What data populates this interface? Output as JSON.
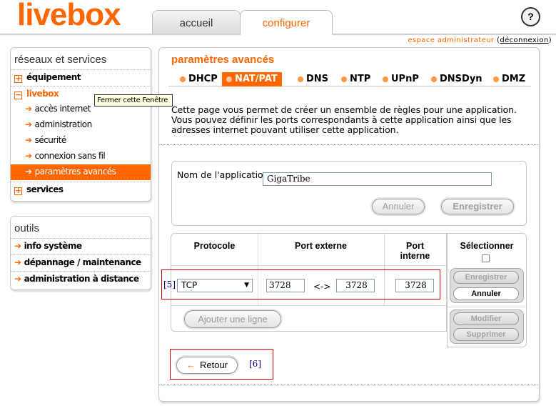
{
  "header": {
    "logo": "livebox",
    "tabs": [
      {
        "label": "accueil",
        "active": false
      },
      {
        "label": "configurer",
        "active": true
      }
    ],
    "help_label": "?",
    "admin_space": "espace administrateur",
    "open_paren": "(",
    "logout": "déconnexion",
    "close_paren": ")"
  },
  "sidebar": {
    "networks": {
      "title": "réseaux et services",
      "items": [
        {
          "label": "équipement",
          "icon": "plus"
        },
        {
          "label": "livebox",
          "icon": "minus"
        },
        {
          "label": "accès internet"
        },
        {
          "label": "administration"
        },
        {
          "label": "sécurité"
        },
        {
          "label": "connexion sans fil"
        },
        {
          "label": "paramètres avancés",
          "active": true
        },
        {
          "label": "services",
          "icon": "plus"
        }
      ]
    },
    "tools": {
      "title": "outils",
      "items": [
        {
          "label": "info système"
        },
        {
          "label": "dépannage / maintenance"
        },
        {
          "label": "administration à distance"
        }
      ]
    }
  },
  "tooltip": "Fermer cette Fenêtre",
  "main": {
    "title": "paramètres avancés",
    "subnav": [
      "DHCP",
      "NAT/PAT",
      "DNS",
      "NTP",
      "UPnP",
      "DNSDyn",
      "DMZ"
    ],
    "subnav_active": "NAT/PAT",
    "description": "Cette page vous permet de créer un ensemble de règles pour une application. Vous pouvez définir les ports correspondants à cette application ainsi que les adresses internet pouvant utiliser cette application.",
    "app_label": "Nom de l'application :",
    "app_value": "GigaTribe",
    "cancel_button": "Annuler",
    "save_button": "Enregistrer",
    "table": {
      "headers": {
        "protocol": "Protocole",
        "external_port": "Port externe",
        "internal_port": "Port interne",
        "select": "Sélectionner"
      },
      "row": {
        "marker": "[5]",
        "protocol": "TCP",
        "ext_port_from": "3728",
        "separator": "<->",
        "ext_port_to": "3728",
        "int_port": "3728"
      },
      "row_buttons": {
        "save": "Enregistrer",
        "cancel": "Annuler"
      },
      "edit_buttons": {
        "modify": "Modifier",
        "delete": "Supprimer"
      },
      "add_line": "Ajouter une ligne"
    },
    "back_button": "Retour",
    "back_marker": "[6]"
  },
  "colors": {
    "accent": "#ff6600",
    "marker_outline": "#d40000"
  }
}
